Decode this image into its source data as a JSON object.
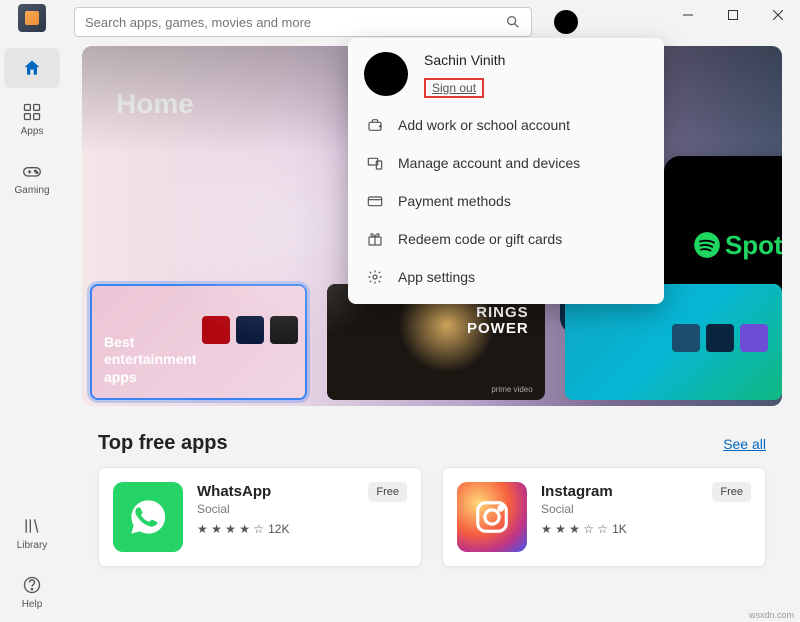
{
  "window": {
    "minimize": "minimize",
    "maximize": "maximize",
    "close": "close"
  },
  "search": {
    "placeholder": "Search apps, games, movies and more"
  },
  "user": {
    "name": "Sachin Vinith",
    "sign_out": "Sign out"
  },
  "sidebar": {
    "home": "Home",
    "apps": "Apps",
    "gaming": "Gaming",
    "library": "Library",
    "help": "Help"
  },
  "hero": {
    "title": "Home"
  },
  "hero_cards": {
    "best_ent": "Best entertainment apps",
    "rings": {
      "line1": "RINGS",
      "line2": "POWER",
      "sub": "prime video"
    },
    "spotify": "Spotify"
  },
  "popup": {
    "items": [
      "Add work or school account",
      "Manage account and devices",
      "Payment methods",
      "Redeem code or gift cards",
      "App settings"
    ]
  },
  "section": {
    "title": "Top free apps",
    "see_all": "See all"
  },
  "top_apps": [
    {
      "name": "WhatsApp",
      "category": "Social",
      "rating": 4,
      "count": "12K",
      "price": "Free"
    },
    {
      "name": "Instagram",
      "category": "Social",
      "rating": 3,
      "count": "1K",
      "price": "Free"
    }
  ],
  "watermark": "wsxdn.com"
}
